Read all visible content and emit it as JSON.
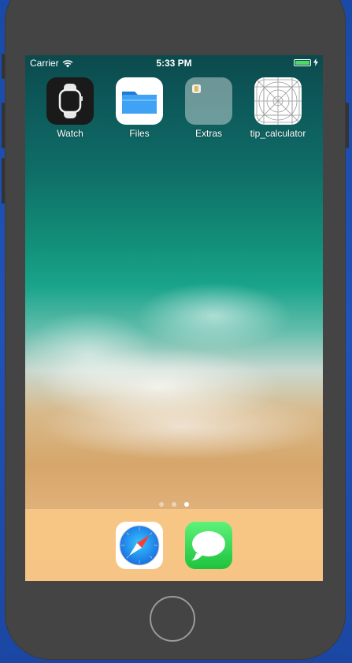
{
  "status_bar": {
    "carrier": "Carrier",
    "time": "5:33 PM"
  },
  "home_screen": {
    "apps": [
      {
        "label": "Watch",
        "icon": "watch-icon"
      },
      {
        "label": "Files",
        "icon": "files-icon"
      },
      {
        "label": "Extras",
        "icon": "extras-folder-icon"
      },
      {
        "label": "tip_calculator",
        "icon": "tip-calculator-icon"
      }
    ],
    "page_indicator": {
      "pages": 3,
      "current": 3
    }
  },
  "dock": {
    "apps": [
      {
        "name": "Safari",
        "icon": "safari-icon"
      },
      {
        "name": "Messages",
        "icon": "messages-icon"
      }
    ]
  },
  "colors": {
    "battery": "#4cd964",
    "dock": "#f8c887",
    "device_frame": "#444444",
    "background": "#1d4fb0"
  }
}
